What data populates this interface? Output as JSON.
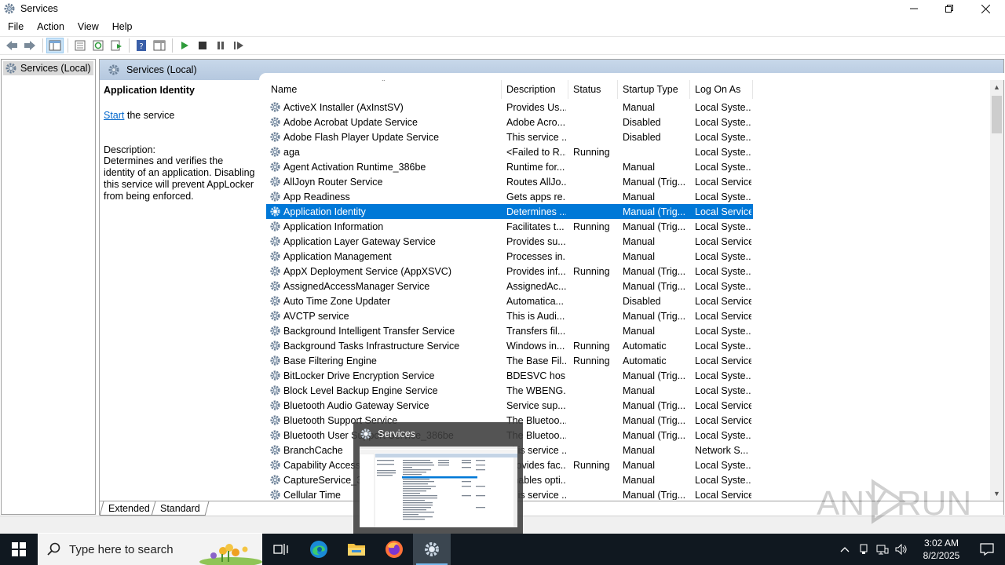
{
  "window": {
    "title": "Services"
  },
  "menu": [
    "File",
    "Action",
    "View",
    "Help"
  ],
  "tree": {
    "root": "Services (Local)"
  },
  "pane": {
    "header": "Services (Local)"
  },
  "detail": {
    "title": "Application Identity",
    "start_link": "Start",
    "start_suffix": " the service",
    "description_label": "Description:",
    "description": "Determines and verifies the identity of an application. Disabling this service will prevent AppLocker from being enforced."
  },
  "columns": [
    "Name",
    "Description",
    "Status",
    "Startup Type",
    "Log On As"
  ],
  "services": [
    {
      "name": "ActiveX Installer (AxInstSV)",
      "desc": "Provides Us...",
      "status": "",
      "startup": "Manual",
      "logon": "Local Syste..."
    },
    {
      "name": "Adobe Acrobat Update Service",
      "desc": "Adobe Acro...",
      "status": "",
      "startup": "Disabled",
      "logon": "Local Syste..."
    },
    {
      "name": "Adobe Flash Player Update Service",
      "desc": "This service ...",
      "status": "",
      "startup": "Disabled",
      "logon": "Local Syste..."
    },
    {
      "name": "aga",
      "desc": "<Failed to R...",
      "status": "Running",
      "startup": "",
      "logon": "Local Syste..."
    },
    {
      "name": "Agent Activation Runtime_386be",
      "desc": "Runtime for...",
      "status": "",
      "startup": "Manual",
      "logon": "Local Syste..."
    },
    {
      "name": "AllJoyn Router Service",
      "desc": "Routes AllJo...",
      "status": "",
      "startup": "Manual (Trig...",
      "logon": "Local Service"
    },
    {
      "name": "App Readiness",
      "desc": "Gets apps re...",
      "status": "",
      "startup": "Manual",
      "logon": "Local Syste..."
    },
    {
      "name": "Application Identity",
      "desc": "Determines ...",
      "status": "",
      "startup": "Manual (Trig...",
      "logon": "Local Service",
      "selected": true
    },
    {
      "name": "Application Information",
      "desc": "Facilitates t...",
      "status": "Running",
      "startup": "Manual (Trig...",
      "logon": "Local Syste..."
    },
    {
      "name": "Application Layer Gateway Service",
      "desc": "Provides su...",
      "status": "",
      "startup": "Manual",
      "logon": "Local Service"
    },
    {
      "name": "Application Management",
      "desc": "Processes in...",
      "status": "",
      "startup": "Manual",
      "logon": "Local Syste..."
    },
    {
      "name": "AppX Deployment Service (AppXSVC)",
      "desc": "Provides inf...",
      "status": "Running",
      "startup": "Manual (Trig...",
      "logon": "Local Syste..."
    },
    {
      "name": "AssignedAccessManager Service",
      "desc": "AssignedAc...",
      "status": "",
      "startup": "Manual (Trig...",
      "logon": "Local Syste..."
    },
    {
      "name": "Auto Time Zone Updater",
      "desc": "Automatica...",
      "status": "",
      "startup": "Disabled",
      "logon": "Local Service"
    },
    {
      "name": "AVCTP service",
      "desc": "This is Audi...",
      "status": "",
      "startup": "Manual (Trig...",
      "logon": "Local Service"
    },
    {
      "name": "Background Intelligent Transfer Service",
      "desc": "Transfers fil...",
      "status": "",
      "startup": "Manual",
      "logon": "Local Syste..."
    },
    {
      "name": "Background Tasks Infrastructure Service",
      "desc": "Windows in...",
      "status": "Running",
      "startup": "Automatic",
      "logon": "Local Syste..."
    },
    {
      "name": "Base Filtering Engine",
      "desc": "The Base Fil...",
      "status": "Running",
      "startup": "Automatic",
      "logon": "Local Service"
    },
    {
      "name": "BitLocker Drive Encryption Service",
      "desc": "BDESVC hos...",
      "status": "",
      "startup": "Manual (Trig...",
      "logon": "Local Syste..."
    },
    {
      "name": "Block Level Backup Engine Service",
      "desc": "The WBENG...",
      "status": "",
      "startup": "Manual",
      "logon": "Local Syste..."
    },
    {
      "name": "Bluetooth Audio Gateway Service",
      "desc": "Service sup...",
      "status": "",
      "startup": "Manual (Trig...",
      "logon": "Local Service"
    },
    {
      "name": "Bluetooth Support Service",
      "desc": "The Bluetoo...",
      "status": "",
      "startup": "Manual (Trig...",
      "logon": "Local Service"
    },
    {
      "name": "Bluetooth User Support Service_386be",
      "desc": "The Bluetoo...",
      "status": "",
      "startup": "Manual (Trig...",
      "logon": "Local Syste..."
    },
    {
      "name": "BranchCache",
      "desc": "This service ...",
      "status": "",
      "startup": "Manual",
      "logon": "Network S..."
    },
    {
      "name": "Capability Access Manager Service",
      "desc": "Provides fac...",
      "status": "Running",
      "startup": "Manual",
      "logon": "Local Syste..."
    },
    {
      "name": "CaptureService_386be",
      "desc": "Enables opti...",
      "status": "",
      "startup": "Manual",
      "logon": "Local Syste..."
    },
    {
      "name": "Cellular Time",
      "desc": "This service ...",
      "status": "",
      "startup": "Manual (Trig...",
      "logon": "Local Service"
    }
  ],
  "tabs": [
    "Extended",
    "Standard"
  ],
  "thumbnail": {
    "title": "Services"
  },
  "taskbar": {
    "search_placeholder": "Type here to search",
    "time": "3:02 AM",
    "date": "8/2/2025"
  },
  "watermark": "ANY RUN",
  "colors": {
    "selection": "#0078d7",
    "taskbar": "#101820",
    "link": "#0066cc"
  },
  "icons": [
    "gear-icon",
    "back-icon",
    "forward-icon",
    "play-icon",
    "stop-icon",
    "pause-icon",
    "resume-icon",
    "windows-logo-icon",
    "search-icon",
    "task-view-icon",
    "edge-icon",
    "file-explorer-icon",
    "firefox-icon"
  ]
}
